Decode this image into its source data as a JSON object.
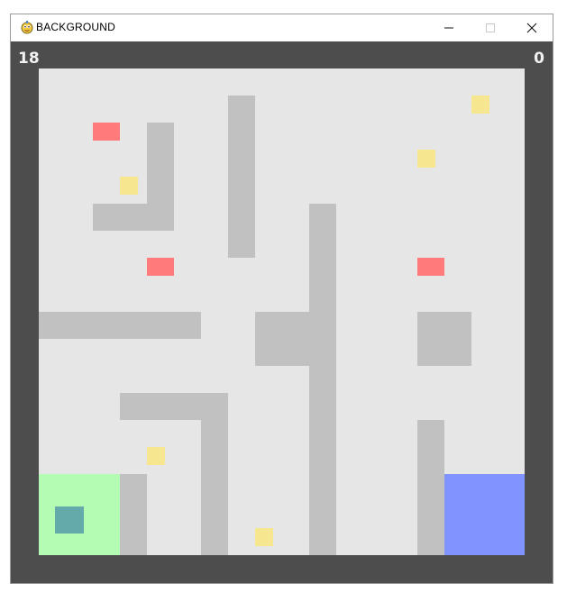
{
  "window": {
    "title": "BACKGROUND",
    "minimize_label": "─",
    "maximize_label": "☐",
    "close_label": "✕",
    "app_icon": "pygame-snake-icon"
  },
  "hud": {
    "timer": "18",
    "score": "0"
  },
  "colors": {
    "frame": "#4d4d4d",
    "floor": "#e6e6e6",
    "wall": "#c1c1c1",
    "enemy": "#ff7a7a",
    "coin": "#f5e68f",
    "start_zone": "#b4fcb4",
    "goal_zone": "#8093ff",
    "player": "#64aaaa"
  }
}
